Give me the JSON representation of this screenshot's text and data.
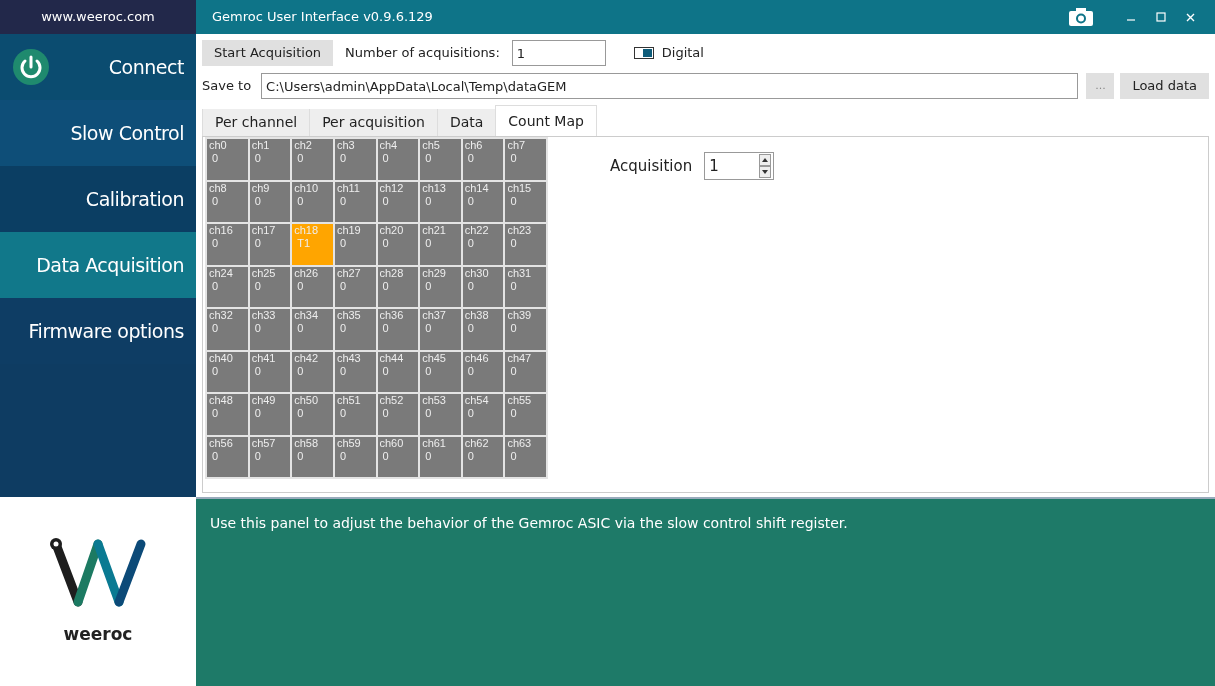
{
  "website": "www.weeroc.com",
  "window": {
    "title": "Gemroc User Interface v0.9.6.129"
  },
  "sidebar": {
    "items": [
      {
        "label": "Connect",
        "kind": "power",
        "selected": false
      },
      {
        "label": "Slow Control",
        "kind": "plain",
        "selected": false
      },
      {
        "label": "Calibration",
        "kind": "plain",
        "selected": false
      },
      {
        "label": "Data Acquisition",
        "kind": "plain",
        "selected": true
      },
      {
        "label": "Firmware options",
        "kind": "plain",
        "selected": false
      }
    ]
  },
  "toolbar": {
    "start_button": "Start Acquisition",
    "acquisitions_label": "Number of acquisitions:",
    "acquisitions_value": "1",
    "digital": {
      "label": "Digital",
      "on": true
    },
    "save_label": "Save to",
    "save_path": "C:\\Users\\admin\\AppData\\Local\\Temp\\dataGEM",
    "browse_button": "...",
    "load_button": "Load data"
  },
  "tabs": [
    {
      "label": "Per channel",
      "selected": false
    },
    {
      "label": "Per acquisition",
      "selected": false
    },
    {
      "label": "Data",
      "selected": false
    },
    {
      "label": "Count Map",
      "selected": true
    }
  ],
  "count_map": {
    "cells": [
      {
        "label": "ch0",
        "value": "0",
        "hit": false
      },
      {
        "label": "ch1",
        "value": "0",
        "hit": false
      },
      {
        "label": "ch2",
        "value": "0",
        "hit": false
      },
      {
        "label": "ch3",
        "value": "0",
        "hit": false
      },
      {
        "label": "ch4",
        "value": "0",
        "hit": false
      },
      {
        "label": "ch5",
        "value": "0",
        "hit": false
      },
      {
        "label": "ch6",
        "value": "0",
        "hit": false
      },
      {
        "label": "ch7",
        "value": "0",
        "hit": false
      },
      {
        "label": "ch8",
        "value": "0",
        "hit": false
      },
      {
        "label": "ch9",
        "value": "0",
        "hit": false
      },
      {
        "label": "ch10",
        "value": "0",
        "hit": false
      },
      {
        "label": "ch11",
        "value": "0",
        "hit": false
      },
      {
        "label": "ch12",
        "value": "0",
        "hit": false
      },
      {
        "label": "ch13",
        "value": "0",
        "hit": false
      },
      {
        "label": "ch14",
        "value": "0",
        "hit": false
      },
      {
        "label": "ch15",
        "value": "0",
        "hit": false
      },
      {
        "label": "ch16",
        "value": "0",
        "hit": false
      },
      {
        "label": "ch17",
        "value": "0",
        "hit": false
      },
      {
        "label": "ch18",
        "value": "T1",
        "hit": true
      },
      {
        "label": "ch19",
        "value": "0",
        "hit": false
      },
      {
        "label": "ch20",
        "value": "0",
        "hit": false
      },
      {
        "label": "ch21",
        "value": "0",
        "hit": false
      },
      {
        "label": "ch22",
        "value": "0",
        "hit": false
      },
      {
        "label": "ch23",
        "value": "0",
        "hit": false
      },
      {
        "label": "ch24",
        "value": "0",
        "hit": false
      },
      {
        "label": "ch25",
        "value": "0",
        "hit": false
      },
      {
        "label": "ch26",
        "value": "0",
        "hit": false
      },
      {
        "label": "ch27",
        "value": "0",
        "hit": false
      },
      {
        "label": "ch28",
        "value": "0",
        "hit": false
      },
      {
        "label": "ch29",
        "value": "0",
        "hit": false
      },
      {
        "label": "ch30",
        "value": "0",
        "hit": false
      },
      {
        "label": "ch31",
        "value": "0",
        "hit": false
      },
      {
        "label": "ch32",
        "value": "0",
        "hit": false
      },
      {
        "label": "ch33",
        "value": "0",
        "hit": false
      },
      {
        "label": "ch34",
        "value": "0",
        "hit": false
      },
      {
        "label": "ch35",
        "value": "0",
        "hit": false
      },
      {
        "label": "ch36",
        "value": "0",
        "hit": false
      },
      {
        "label": "ch37",
        "value": "0",
        "hit": false
      },
      {
        "label": "ch38",
        "value": "0",
        "hit": false
      },
      {
        "label": "ch39",
        "value": "0",
        "hit": false
      },
      {
        "label": "ch40",
        "value": "0",
        "hit": false
      },
      {
        "label": "ch41",
        "value": "0",
        "hit": false
      },
      {
        "label": "ch42",
        "value": "0",
        "hit": false
      },
      {
        "label": "ch43",
        "value": "0",
        "hit": false
      },
      {
        "label": "ch44",
        "value": "0",
        "hit": false
      },
      {
        "label": "ch45",
        "value": "0",
        "hit": false
      },
      {
        "label": "ch46",
        "value": "0",
        "hit": false
      },
      {
        "label": "ch47",
        "value": "0",
        "hit": false
      },
      {
        "label": "ch48",
        "value": "0",
        "hit": false
      },
      {
        "label": "ch49",
        "value": "0",
        "hit": false
      },
      {
        "label": "ch50",
        "value": "0",
        "hit": false
      },
      {
        "label": "ch51",
        "value": "0",
        "hit": false
      },
      {
        "label": "ch52",
        "value": "0",
        "hit": false
      },
      {
        "label": "ch53",
        "value": "0",
        "hit": false
      },
      {
        "label": "ch54",
        "value": "0",
        "hit": false
      },
      {
        "label": "ch55",
        "value": "0",
        "hit": false
      },
      {
        "label": "ch56",
        "value": "0",
        "hit": false
      },
      {
        "label": "ch57",
        "value": "0",
        "hit": false
      },
      {
        "label": "ch58",
        "value": "0",
        "hit": false
      },
      {
        "label": "ch59",
        "value": "0",
        "hit": false
      },
      {
        "label": "ch60",
        "value": "0",
        "hit": false
      },
      {
        "label": "ch61",
        "value": "0",
        "hit": false
      },
      {
        "label": "ch62",
        "value": "0",
        "hit": false
      },
      {
        "label": "ch63",
        "value": "0",
        "hit": false
      }
    ],
    "acquisition_label": "Acquisition",
    "acquisition_value": "1"
  },
  "logo_text": "weeroc",
  "help_text": "Use this panel to adjust the behavior of the Gemroc ASIC via the slow control shift register."
}
